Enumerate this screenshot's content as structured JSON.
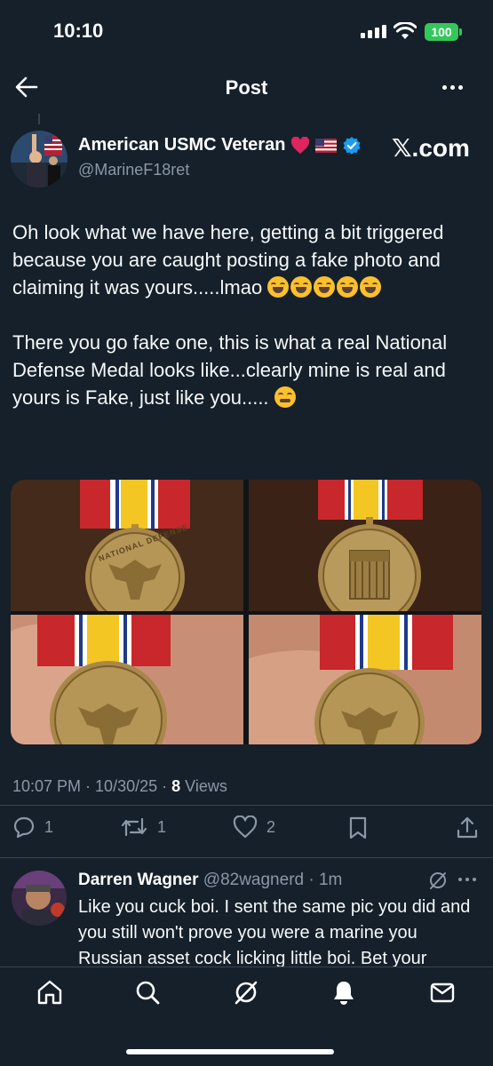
{
  "status_bar": {
    "time": "10:10",
    "battery": "100"
  },
  "header": {
    "title": "Post"
  },
  "post": {
    "author_name": "American USMC Veteran",
    "handle": "@MarineF18ret",
    "site_badge": "𝕏.com",
    "text_p1": "Oh look what we have here, getting a bit triggered because you are caught posting a fake photo and claiming it was yours.....lmao",
    "text_p2": "There you go fake one, this is what a real National Defense Medal looks like...clearly mine is real and yours is Fake, just like you.....",
    "timestamp": "10:07 PM · 10/30/25 · ",
    "views_count": "8",
    "views_label": "Views",
    "medal_inscription": "NATIONAL DEFENSE"
  },
  "actions": {
    "replies": "1",
    "reposts": "1",
    "likes": "2"
  },
  "reply": {
    "name": "Darren Wagner",
    "handle_time": "@82wagnerd · 1m",
    "text": "Like you cuck boi. I sent the same pic you did and you still won't prove you were a marine you Russian asset cock licking little boi. Bet your"
  },
  "nav": {
    "icons": [
      "home-icon",
      "search-icon",
      "grok-icon",
      "notifications-icon",
      "messages-icon"
    ]
  },
  "colors": {
    "background": "#15202b",
    "secondary_text": "#8b98a5",
    "verified": "#1d9bf0",
    "battery": "#34c759"
  }
}
